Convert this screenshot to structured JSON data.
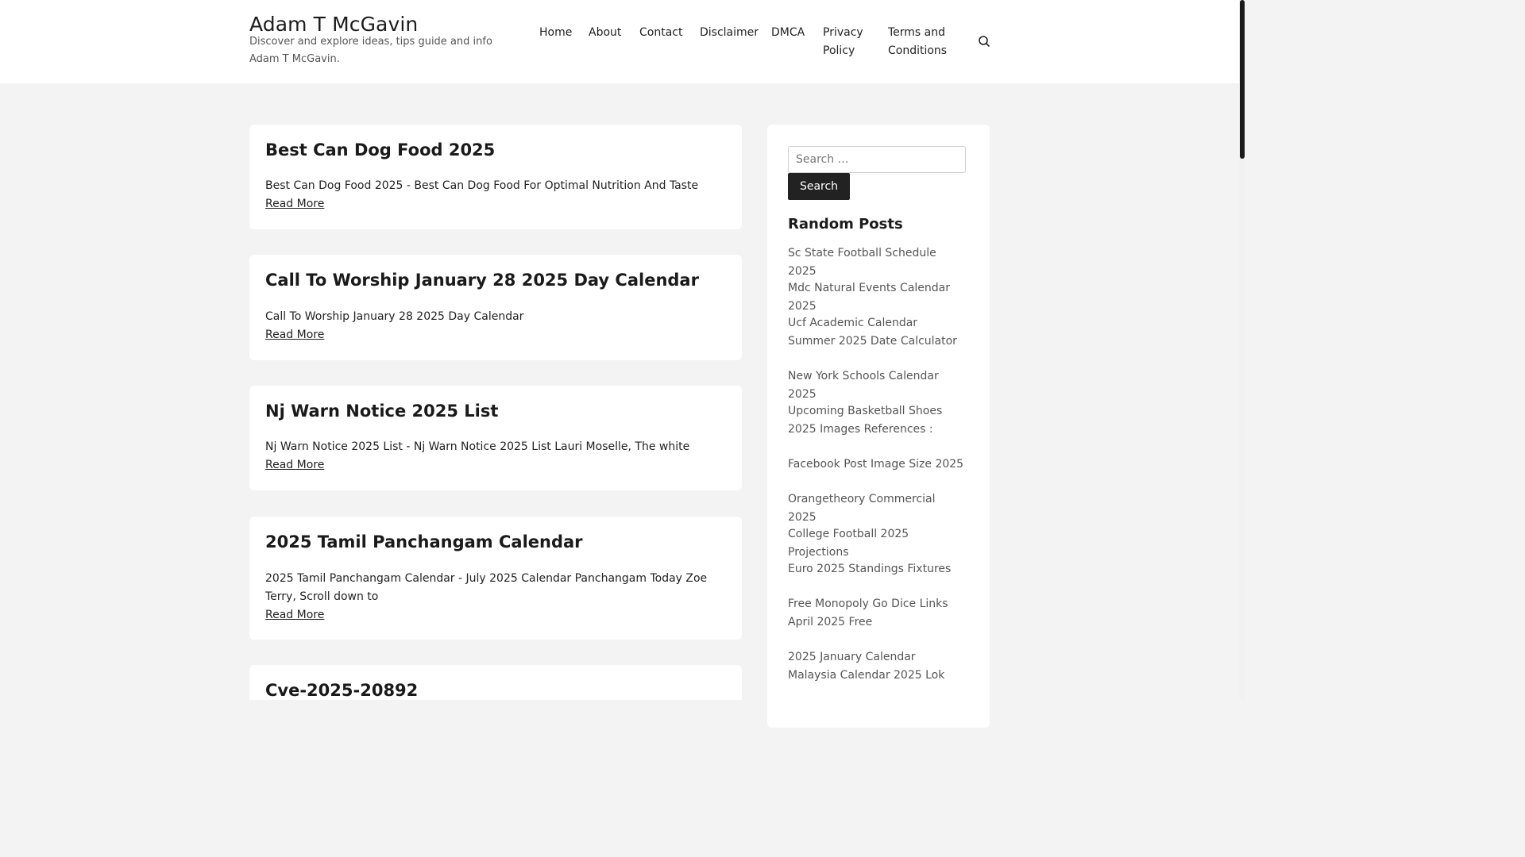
{
  "header": {
    "title": "Adam T McGavin",
    "description": "Discover and explore ideas, tips guide and info Adam T McGavin.",
    "nav": [
      "Home",
      "About",
      "Contact",
      "Disclaimer",
      "DMCA",
      "Privacy Policy",
      "Terms and Conditions"
    ],
    "search_icon": "search-icon"
  },
  "posts": [
    {
      "title": "Best Can Dog Food 2025",
      "excerpt": "Best Can Dog Food 2025 - Best Can Dog Food For Optimal Nutrition And Taste",
      "read_more": "Read More"
    },
    {
      "title": "Call To Worship January 28 2025 Day Calendar",
      "excerpt": "Call To Worship January 28 2025 Day Calendar",
      "read_more": "Read More"
    },
    {
      "title": "Nj Warn Notice 2025 List",
      "excerpt": "Nj Warn Notice 2025 List - Nj Warn Notice 2025 List Lauri Moselle, The white",
      "read_more": "Read More"
    },
    {
      "title": "2025 Tamil Panchangam Calendar",
      "excerpt": "2025 Tamil Panchangam Calendar - July 2025 Calendar Panchangam Today Zoe Terry, Scroll down to",
      "read_more": "Read More"
    },
    {
      "title": "Cve-2025-20892"
    }
  ],
  "sidebar": {
    "search_placeholder": "Search …",
    "search_button": "Search",
    "widget_title": "Random Posts",
    "random_posts": [
      "Sc State Football Schedule 2025",
      "Mdc Natural Events Calendar 2025",
      "Ucf Academic Calendar Summer 2025 Date Calculator",
      "New York Schools Calendar 2025",
      "Upcoming Basketball Shoes 2025 Images References :",
      "Facebook Post Image Size 2025",
      "Orangetheory Commercial 2025",
      "College Football 2025 Projections",
      "Euro 2025 Standings Fixtures",
      "Free Monopoly Go Dice Links April 2025 Free",
      "2025 January Calendar Malaysia Calendar 2025 Lok"
    ]
  }
}
